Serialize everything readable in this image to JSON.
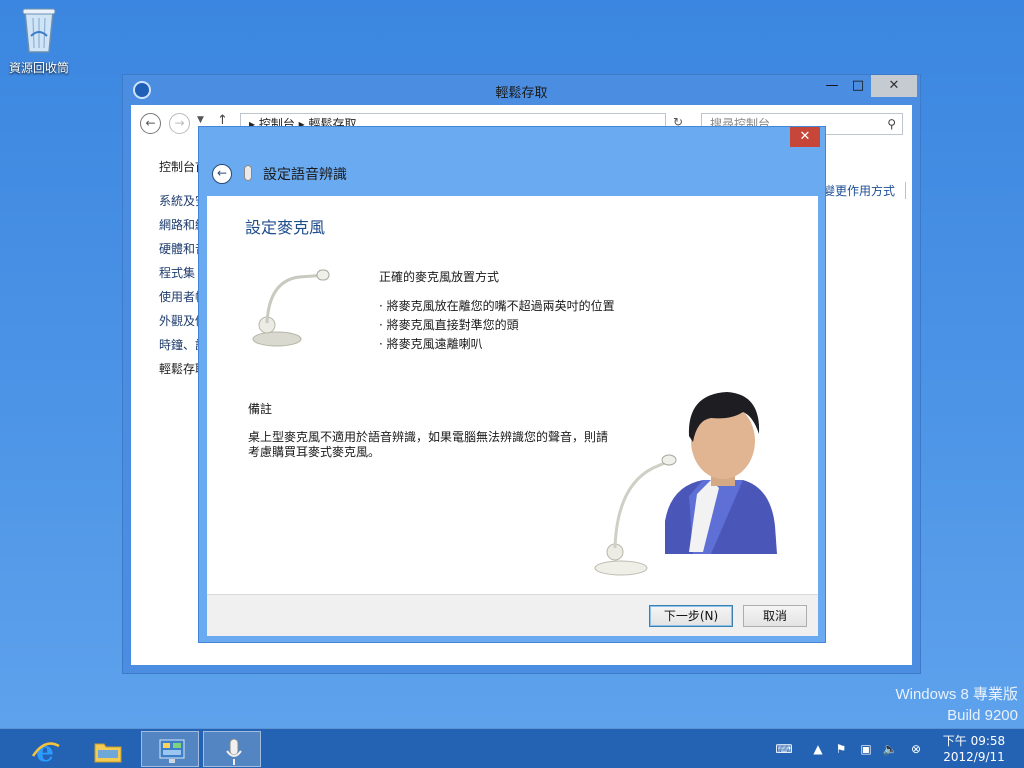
{
  "desktop": {
    "recycle_bin_label": "資源回收筒",
    "watermark_line1": "Windows 8 專業版",
    "watermark_line2": "Build 9200"
  },
  "control_panel": {
    "title": "輕鬆存取",
    "address": "▸ 控制台 ▸ 輕鬆存取",
    "search_placeholder": "搜尋控制台",
    "nav_home": "控制台首頁",
    "nav_items": [
      "系統及安全性",
      "網路和網際網路",
      "硬體和音效",
      "程式集",
      "使用者帳戶",
      "外觀及個人化",
      "時鐘、語言和區域",
      "輕鬆存取"
    ],
    "side_link": "變更作用方式"
  },
  "dialog": {
    "header_title": "設定語音辨識",
    "section_title": "設定麥克風",
    "placement_title": "正確的麥克風放置方式",
    "tips": [
      "· 將麥克風放在離您的嘴不超過兩英吋的位置",
      "· 將麥克風直接對準您的頭",
      "· 將麥克風遠離喇叭"
    ],
    "note_title": "備註",
    "note_body": "桌上型麥克風不適用於語音辨識，如果電腦無法辨識您的聲音，則請考慮購買耳麥式麥克風。",
    "next_button": "下一步(N)",
    "cancel_button": "取消"
  },
  "taskbar": {
    "apps": [
      "internet-explorer",
      "file-explorer",
      "control-panel",
      "speech-recognition"
    ],
    "clock_time": "下午 09:58",
    "clock_date": "2012/9/11"
  }
}
